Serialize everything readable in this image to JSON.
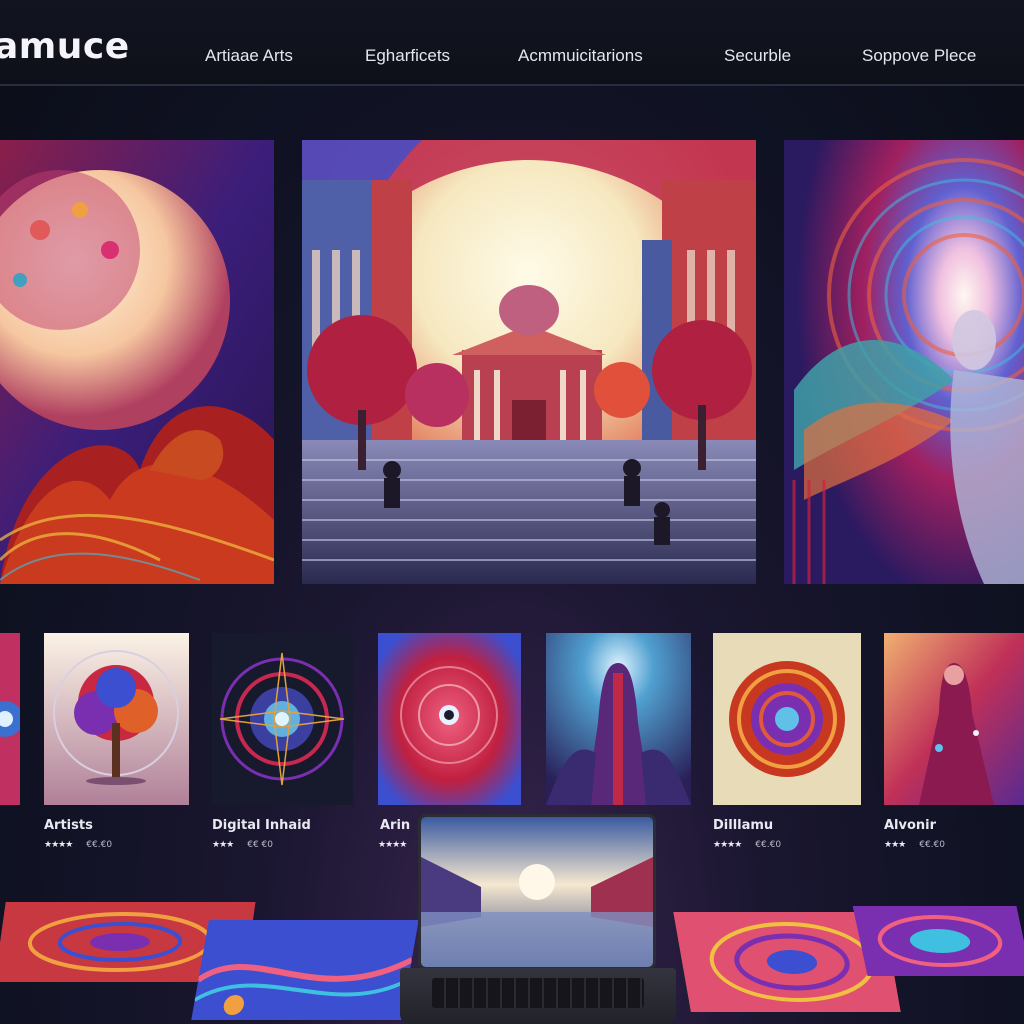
{
  "brand": {
    "name": "amuce"
  },
  "nav": {
    "items": [
      {
        "label": "Artiaae Arts"
      },
      {
        "label": "Egharficets"
      },
      {
        "label": "Acmmuicitarions"
      },
      {
        "label": "Securble"
      },
      {
        "label": "Soppove Plece"
      }
    ]
  },
  "gallery": {
    "cards": [
      {
        "title": "Artists",
        "rating_stars": "★★★★",
        "price": "€€.€0"
      },
      {
        "title": "Digital Inhaid",
        "rating_stars": "★★★",
        "price": "€€ €0"
      },
      {
        "title": "Arin",
        "rating_stars": "★★★★",
        "price": ""
      },
      {
        "title": "Dilllamu",
        "rating_stars": "★★★★",
        "price": "€€.€0"
      },
      {
        "title": "Alvonir",
        "rating_stars": "★★★",
        "price": "€€.€0"
      }
    ],
    "rating_outof": 5
  },
  "colors": {
    "background": "#0f1222",
    "navbar": "#121420",
    "text": "#e8e8f0",
    "accent_red": "#c8283a",
    "accent_blue": "#3b4fd0",
    "accent_purple": "#7b2fb0"
  },
  "icons": [
    "star-icon"
  ]
}
